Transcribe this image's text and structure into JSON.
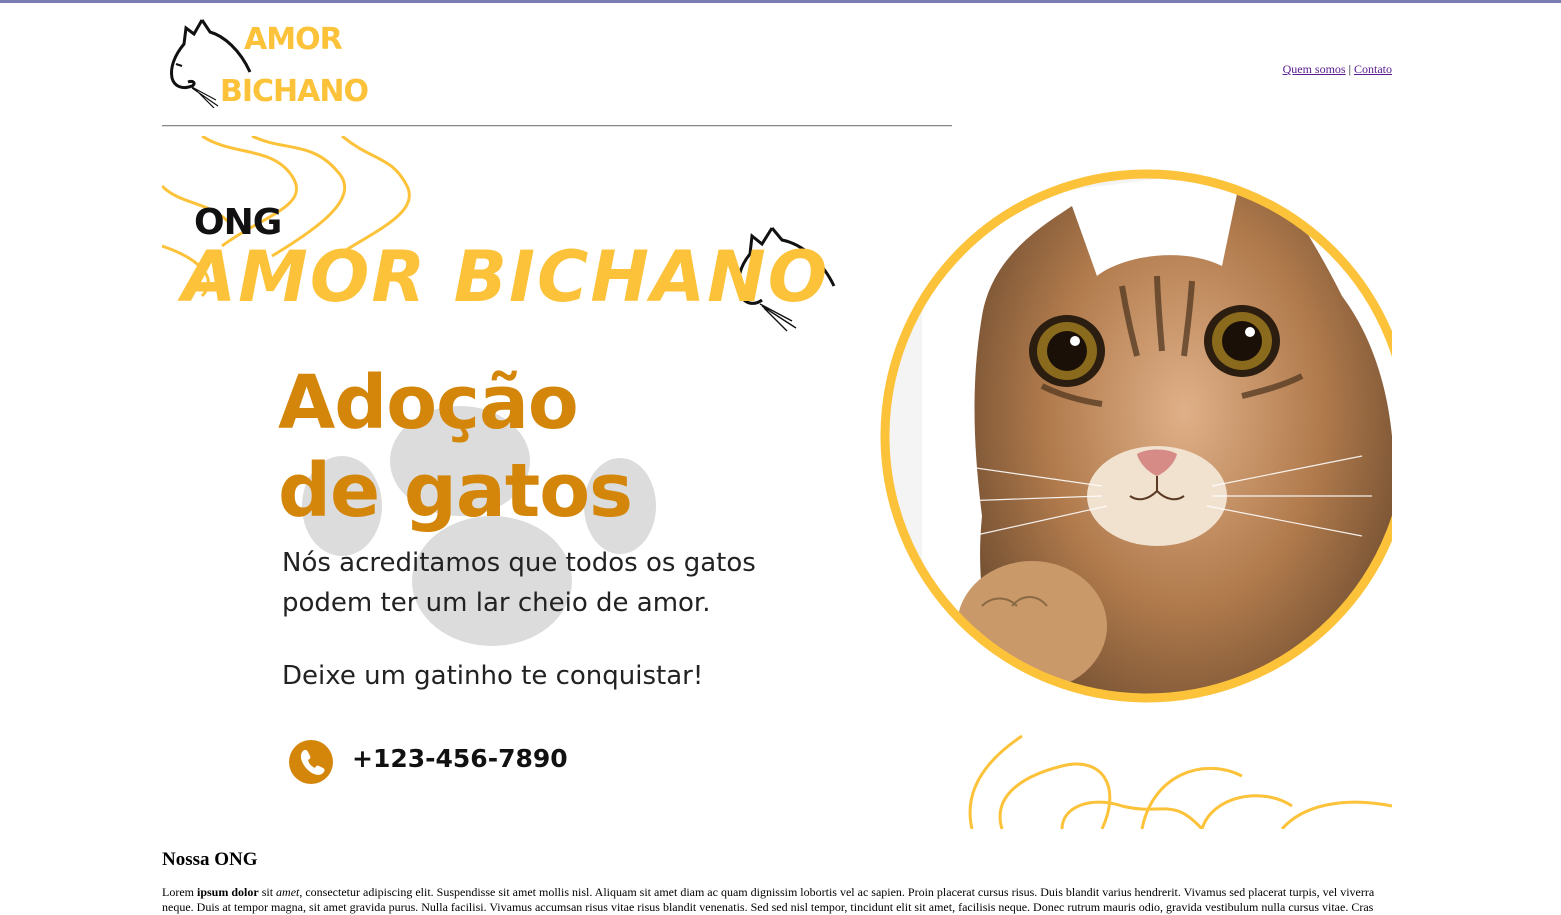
{
  "header": {
    "logo_line1": "AMOR",
    "logo_line2": "BICHANO",
    "nav": {
      "about": "Quem somos",
      "separator": "|",
      "contact": "Contato"
    }
  },
  "banner": {
    "ong": "ONG",
    "brand": "AMOR BICHANO",
    "headline_line1": "Adoção",
    "headline_line2": "de gatos",
    "belief_line1": "Nós acreditamos que todos os gatos",
    "belief_line2": "podem ter um lar cheio de amor.",
    "cta": "Deixe um gatinho te conquistar!",
    "phone": "+123-456-7890"
  },
  "section": {
    "title": "Nossa ONG",
    "lorem_word": "Lorem",
    "bold_words": "ipsum dolor",
    "sit": "sit",
    "italic_word": "amet",
    "text_rest": ", consectetur adipiscing elit. Suspendisse sit amet mollis nisl. Aliquam sit amet diam ac quam dignissim lobortis vel ac sapien. Proin placerat cursus risus. Duis blandit varius hendrerit. Vivamus sed placerat turpis, vel viverra neque. Duis at tempor magna, sit amet gravida purus. Nulla facilisi. Vivamus accumsan risus vitae risus blandit venenatis. Sed sed nisl tempor, tincidunt elit sit amet, facilisis neque. Donec rutrum mauris odio, gravida vestibulum nulla cursus vitae. Cras"
  },
  "colors": {
    "accent_yellow": "#fcc23a",
    "accent_orange": "#d4860b",
    "top_border": "#7b7cb4",
    "link": "#551a8b"
  },
  "icons": [
    "cat-silhouette-icon",
    "paw-icon",
    "phone-icon"
  ]
}
